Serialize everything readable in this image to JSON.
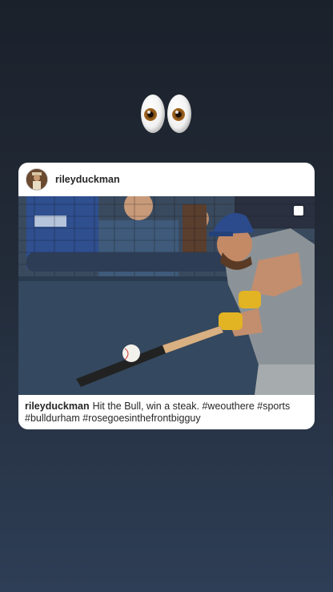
{
  "sticker": {
    "icon": "eyes-emoji"
  },
  "post": {
    "username": "rileyduckman",
    "caption_username": "rileyduckman",
    "caption_text": "Hit the Bull, win a steak. #weouthere #sports #bulldurham #rosegoesinthefrontbigguy",
    "avatar_icon": "profile-avatar",
    "multi_photo_icon": "square-icon"
  },
  "colors": {
    "background_top": "#1b212b",
    "background_bottom": "#2e3e56",
    "card": "#ffffff",
    "text": "#262626"
  }
}
